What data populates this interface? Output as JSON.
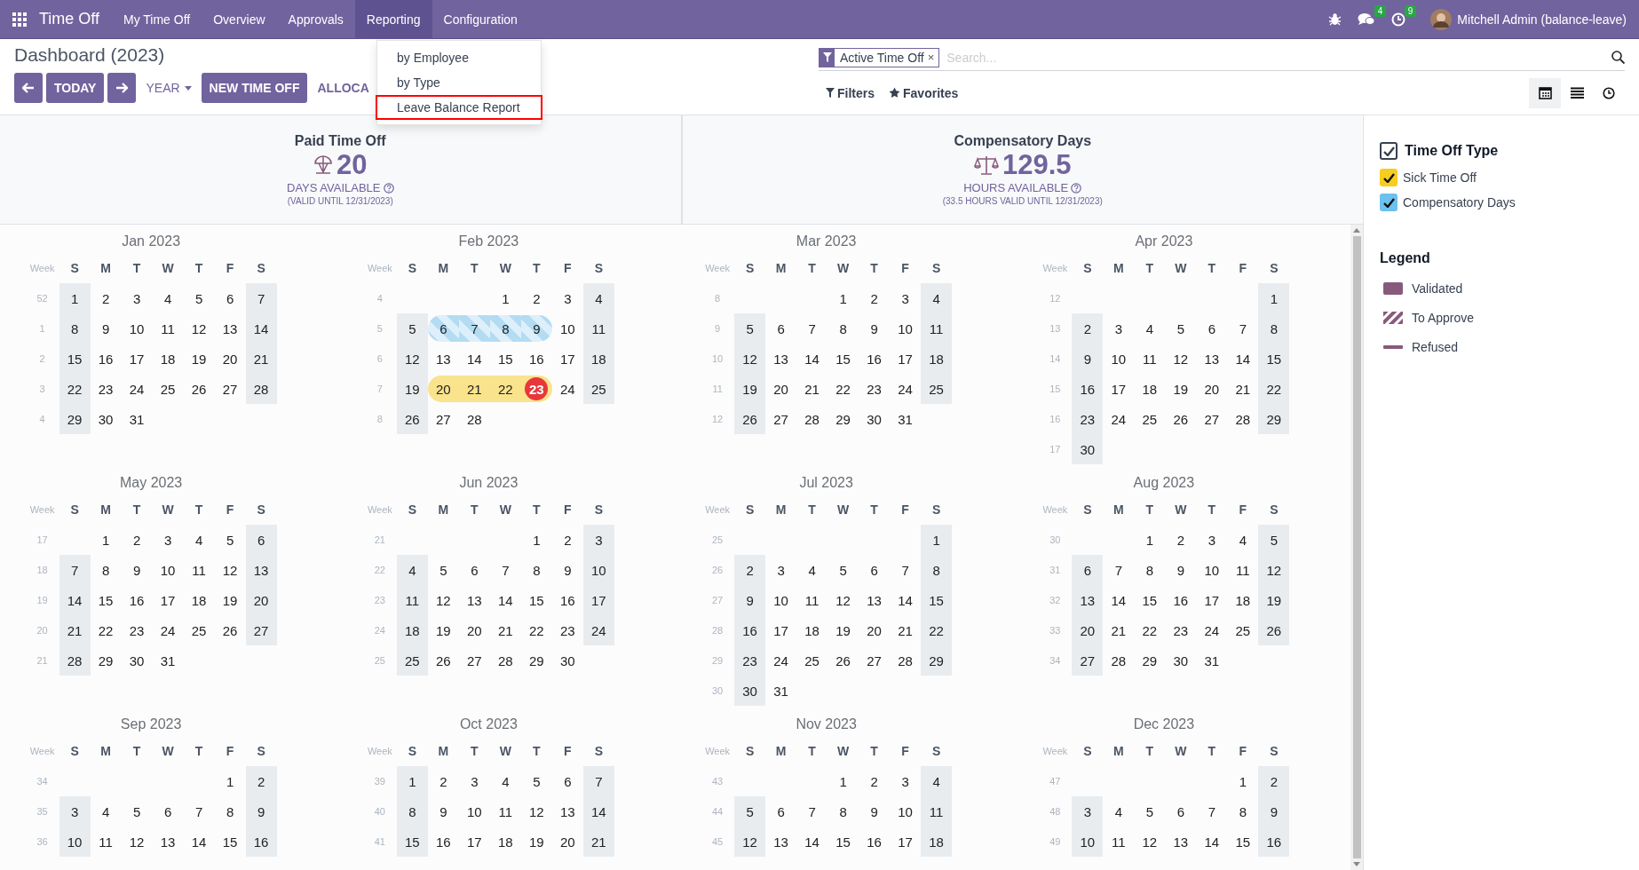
{
  "navbar": {
    "app_name": "Time Off",
    "menus": [
      {
        "label": "My Time Off",
        "selected": false
      },
      {
        "label": "Overview",
        "selected": false
      },
      {
        "label": "Approvals",
        "selected": false
      },
      {
        "label": "Reporting",
        "selected": true
      },
      {
        "label": "Configuration",
        "selected": false
      }
    ],
    "messages_badge": "4",
    "activities_badge": "9",
    "user": "Mitchell Admin (balance-leave)"
  },
  "reporting_menu": [
    {
      "label": "by Employee",
      "highlighted": false
    },
    {
      "label": "by Type",
      "highlighted": false
    },
    {
      "label": "Leave Balance Report",
      "highlighted": true
    }
  ],
  "breadcrumb": "Dashboard (2023)",
  "buttons": {
    "today": "TODAY",
    "scale": "YEAR",
    "new": "NEW TIME OFF",
    "allocation": "ALLOCA"
  },
  "search": {
    "facet": "Active Time Off",
    "facet_remove": "×",
    "placeholder": "Search..."
  },
  "filters": "Filters",
  "favorites": "Favorites",
  "views": [
    {
      "kind": "calendar",
      "selected": true
    },
    {
      "kind": "list",
      "selected": false
    },
    {
      "kind": "activity",
      "selected": false
    }
  ],
  "summaries": [
    {
      "title": "Paid Time Off",
      "value": "20",
      "unit": "DAYS AVAILABLE",
      "note": "(VALID UNTIL 12/31/2023)"
    },
    {
      "title": "Compensatory Days",
      "value": "129.5",
      "unit": "HOURS AVAILABLE",
      "note": "(33.5 HOURS VALID UNTIL 12/31/2023)"
    }
  ],
  "months": [
    {
      "title": "Jan 2023",
      "week_label": "Week",
      "weekdays": [
        "S",
        "M",
        "T",
        "W",
        "T",
        "F",
        "S"
      ],
      "weeks": [
        {
          "week": "52",
          "kind": "full",
          "days": [
            "1",
            "2",
            "3",
            "4",
            "5",
            "6",
            "7"
          ]
        },
        {
          "week": "1",
          "kind": "full",
          "days": [
            "8",
            "9",
            "10",
            "11",
            "12",
            "13",
            "14"
          ]
        },
        {
          "week": "2",
          "kind": "full",
          "days": [
            "15",
            "16",
            "17",
            "18",
            "19",
            "20",
            "21"
          ]
        },
        {
          "week": "3",
          "kind": "full",
          "days": [
            "22",
            "23",
            "24",
            "25",
            "26",
            "27",
            "28"
          ]
        },
        {
          "week": "4",
          "kind": "tail",
          "days": [
            "29",
            "30",
            "31"
          ]
        }
      ]
    },
    {
      "title": "Feb 2023",
      "week_label": "Week",
      "weekdays": [
        "S",
        "M",
        "T",
        "W",
        "T",
        "F",
        "S"
      ],
      "weeks": [
        {
          "week": "4",
          "kind": "lead",
          "days": [
            "1",
            "2",
            "3",
            "4"
          ]
        },
        {
          "week": "5",
          "kind": "full",
          "days": [
            "5",
            {
              "day": "6",
              "kind": "to_approve",
              "color": "#b3dcf3",
              "today": false
            },
            {
              "day": "7",
              "kind": "to_approve",
              "color": "#b3dcf3",
              "today": false
            },
            {
              "day": "8",
              "kind": "to_approve",
              "color": "#b3dcf3",
              "today": false
            },
            {
              "day": "9",
              "kind": "to_approve",
              "color": "#b3dcf3",
              "today": false
            },
            "10",
            "11"
          ]
        },
        {
          "week": "6",
          "kind": "full",
          "days": [
            "12",
            "13",
            "14",
            "15",
            "16",
            "17",
            "18"
          ]
        },
        {
          "week": "7",
          "kind": "full",
          "days": [
            "19",
            {
              "day": "20",
              "kind": "validated",
              "color": "#f9e38c",
              "today": false
            },
            {
              "day": "21",
              "kind": "validated",
              "color": "#f9e38c",
              "today": false
            },
            {
              "day": "22",
              "kind": "validated",
              "color": "#f9e38c",
              "today": false
            },
            {
              "day": "23",
              "kind": "validated",
              "color": "#f9e38c",
              "today": true
            },
            "24",
            "25"
          ]
        },
        {
          "week": "8",
          "kind": "tail",
          "days": [
            "26",
            "27",
            "28"
          ]
        }
      ]
    },
    {
      "title": "Mar 2023",
      "week_label": "Week",
      "weekdays": [
        "S",
        "M",
        "T",
        "W",
        "T",
        "F",
        "S"
      ],
      "weeks": [
        {
          "week": "8",
          "kind": "lead",
          "days": [
            "1",
            "2",
            "3",
            "4"
          ]
        },
        {
          "week": "9",
          "kind": "full",
          "days": [
            "5",
            "6",
            "7",
            "8",
            "9",
            "10",
            "11"
          ]
        },
        {
          "week": "10",
          "kind": "full",
          "days": [
            "12",
            "13",
            "14",
            "15",
            "16",
            "17",
            "18"
          ]
        },
        {
          "week": "11",
          "kind": "full",
          "days": [
            "19",
            "20",
            "21",
            "22",
            "23",
            "24",
            "25"
          ]
        },
        {
          "week": "12",
          "kind": "tail",
          "days": [
            "26",
            "27",
            "28",
            "29",
            "30",
            "31"
          ]
        }
      ]
    },
    {
      "title": "Apr 2023",
      "week_label": "Week",
      "weekdays": [
        "S",
        "M",
        "T",
        "W",
        "T",
        "F",
        "S"
      ],
      "weeks": [
        {
          "week": "12",
          "kind": "lead",
          "days": [
            "1"
          ]
        },
        {
          "week": "13",
          "kind": "full",
          "days": [
            "2",
            "3",
            "4",
            "5",
            "6",
            "7",
            "8"
          ]
        },
        {
          "week": "14",
          "kind": "full",
          "days": [
            "9",
            "10",
            "11",
            "12",
            "13",
            "14",
            "15"
          ]
        },
        {
          "week": "15",
          "kind": "full",
          "days": [
            "16",
            "17",
            "18",
            "19",
            "20",
            "21",
            "22"
          ]
        },
        {
          "week": "16",
          "kind": "full",
          "days": [
            "23",
            "24",
            "25",
            "26",
            "27",
            "28",
            "29"
          ]
        },
        {
          "week": "17",
          "kind": "tail",
          "days": [
            "30"
          ]
        }
      ]
    },
    {
      "title": "May 2023",
      "week_label": "Week",
      "weekdays": [
        "S",
        "M",
        "T",
        "W",
        "T",
        "F",
        "S"
      ],
      "weeks": [
        {
          "week": "17",
          "kind": "lead",
          "days": [
            "1",
            "2",
            "3",
            "4",
            "5",
            "6"
          ]
        },
        {
          "week": "18",
          "kind": "full",
          "days": [
            "7",
            "8",
            "9",
            "10",
            "11",
            "12",
            "13"
          ]
        },
        {
          "week": "19",
          "kind": "full",
          "days": [
            "14",
            "15",
            "16",
            "17",
            "18",
            "19",
            "20"
          ]
        },
        {
          "week": "20",
          "kind": "full",
          "days": [
            "21",
            "22",
            "23",
            "24",
            "25",
            "26",
            "27"
          ]
        },
        {
          "week": "21",
          "kind": "tail",
          "days": [
            "28",
            "29",
            "30",
            "31"
          ]
        }
      ]
    },
    {
      "title": "Jun 2023",
      "week_label": "Week",
      "weekdays": [
        "S",
        "M",
        "T",
        "W",
        "T",
        "F",
        "S"
      ],
      "weeks": [
        {
          "week": "21",
          "kind": "lead",
          "days": [
            "1",
            "2",
            "3"
          ]
        },
        {
          "week": "22",
          "kind": "full",
          "days": [
            "4",
            "5",
            "6",
            "7",
            "8",
            "9",
            "10"
          ]
        },
        {
          "week": "23",
          "kind": "full",
          "days": [
            "11",
            "12",
            "13",
            "14",
            "15",
            "16",
            "17"
          ]
        },
        {
          "week": "24",
          "kind": "full",
          "days": [
            "18",
            "19",
            "20",
            "21",
            "22",
            "23",
            "24"
          ]
        },
        {
          "week": "25",
          "kind": "tail",
          "days": [
            "25",
            "26",
            "27",
            "28",
            "29",
            "30"
          ]
        }
      ]
    },
    {
      "title": "Jul 2023",
      "week_label": "Week",
      "weekdays": [
        "S",
        "M",
        "T",
        "W",
        "T",
        "F",
        "S"
      ],
      "weeks": [
        {
          "week": "25",
          "kind": "lead",
          "days": [
            "1"
          ]
        },
        {
          "week": "26",
          "kind": "full",
          "days": [
            "2",
            "3",
            "4",
            "5",
            "6",
            "7",
            "8"
          ]
        },
        {
          "week": "27",
          "kind": "full",
          "days": [
            "9",
            "10",
            "11",
            "12",
            "13",
            "14",
            "15"
          ]
        },
        {
          "week": "28",
          "kind": "full",
          "days": [
            "16",
            "17",
            "18",
            "19",
            "20",
            "21",
            "22"
          ]
        },
        {
          "week": "29",
          "kind": "full",
          "days": [
            "23",
            "24",
            "25",
            "26",
            "27",
            "28",
            "29"
          ]
        },
        {
          "week": "30",
          "kind": "tail",
          "days": [
            "30",
            "31"
          ]
        }
      ]
    },
    {
      "title": "Aug 2023",
      "week_label": "Week",
      "weekdays": [
        "S",
        "M",
        "T",
        "W",
        "T",
        "F",
        "S"
      ],
      "weeks": [
        {
          "week": "30",
          "kind": "lead",
          "days": [
            "1",
            "2",
            "3",
            "4",
            "5"
          ]
        },
        {
          "week": "31",
          "kind": "full",
          "days": [
            "6",
            "7",
            "8",
            "9",
            "10",
            "11",
            "12"
          ]
        },
        {
          "week": "32",
          "kind": "full",
          "days": [
            "13",
            "14",
            "15",
            "16",
            "17",
            "18",
            "19"
          ]
        },
        {
          "week": "33",
          "kind": "full",
          "days": [
            "20",
            "21",
            "22",
            "23",
            "24",
            "25",
            "26"
          ]
        },
        {
          "week": "34",
          "kind": "tail",
          "days": [
            "27",
            "28",
            "29",
            "30",
            "31"
          ]
        }
      ]
    },
    {
      "title": "Sep 2023",
      "week_label": "Week",
      "weekdays": [
        "S",
        "M",
        "T",
        "W",
        "T",
        "F",
        "S"
      ],
      "weeks": [
        {
          "week": "34",
          "kind": "lead",
          "days": [
            "1",
            "2"
          ]
        },
        {
          "week": "35",
          "kind": "full",
          "days": [
            "3",
            "4",
            "5",
            "6",
            "7",
            "8",
            "9"
          ]
        },
        {
          "week": "36",
          "kind": "full",
          "days": [
            "10",
            "11",
            "12",
            "13",
            "14",
            "15",
            "16"
          ]
        }
      ]
    },
    {
      "title": "Oct 2023",
      "week_label": "Week",
      "weekdays": [
        "S",
        "M",
        "T",
        "W",
        "T",
        "F",
        "S"
      ],
      "weeks": [
        {
          "week": "39",
          "kind": "full",
          "days": [
            "1",
            "2",
            "3",
            "4",
            "5",
            "6",
            "7"
          ]
        },
        {
          "week": "40",
          "kind": "full",
          "days": [
            "8",
            "9",
            "10",
            "11",
            "12",
            "13",
            "14"
          ]
        },
        {
          "week": "41",
          "kind": "full",
          "days": [
            "15",
            "16",
            "17",
            "18",
            "19",
            "20",
            "21"
          ]
        }
      ]
    },
    {
      "title": "Nov 2023",
      "week_label": "Week",
      "weekdays": [
        "S",
        "M",
        "T",
        "W",
        "T",
        "F",
        "S"
      ],
      "weeks": [
        {
          "week": "43",
          "kind": "lead",
          "days": [
            "1",
            "2",
            "3",
            "4"
          ]
        },
        {
          "week": "44",
          "kind": "full",
          "days": [
            "5",
            "6",
            "7",
            "8",
            "9",
            "10",
            "11"
          ]
        },
        {
          "week": "45",
          "kind": "full",
          "days": [
            "12",
            "13",
            "14",
            "15",
            "16",
            "17",
            "18"
          ]
        }
      ]
    },
    {
      "title": "Dec 2023",
      "week_label": "Week",
      "weekdays": [
        "S",
        "M",
        "T",
        "W",
        "T",
        "F",
        "S"
      ],
      "weeks": [
        {
          "week": "47",
          "kind": "lead",
          "days": [
            "1",
            "2"
          ]
        },
        {
          "week": "48",
          "kind": "full",
          "days": [
            "3",
            "4",
            "5",
            "6",
            "7",
            "8",
            "9"
          ]
        },
        {
          "week": "49",
          "kind": "full",
          "days": [
            "10",
            "11",
            "12",
            "13",
            "14",
            "15",
            "16"
          ]
        }
      ]
    }
  ],
  "filter_panel": {
    "title": "Time Off Type",
    "checked": true,
    "items": [
      {
        "label": "Sick Time Off",
        "checked": true,
        "color": "#f7cd1f"
      },
      {
        "label": "Compensatory Days",
        "checked": true,
        "color": "#6cc1ed"
      }
    ]
  },
  "legend": {
    "title": "Legend",
    "items": [
      {
        "label": "Validated",
        "kind": "validated"
      },
      {
        "label": "To Approve",
        "kind": "to_approve"
      },
      {
        "label": "Refused",
        "kind": "refused"
      }
    ]
  }
}
